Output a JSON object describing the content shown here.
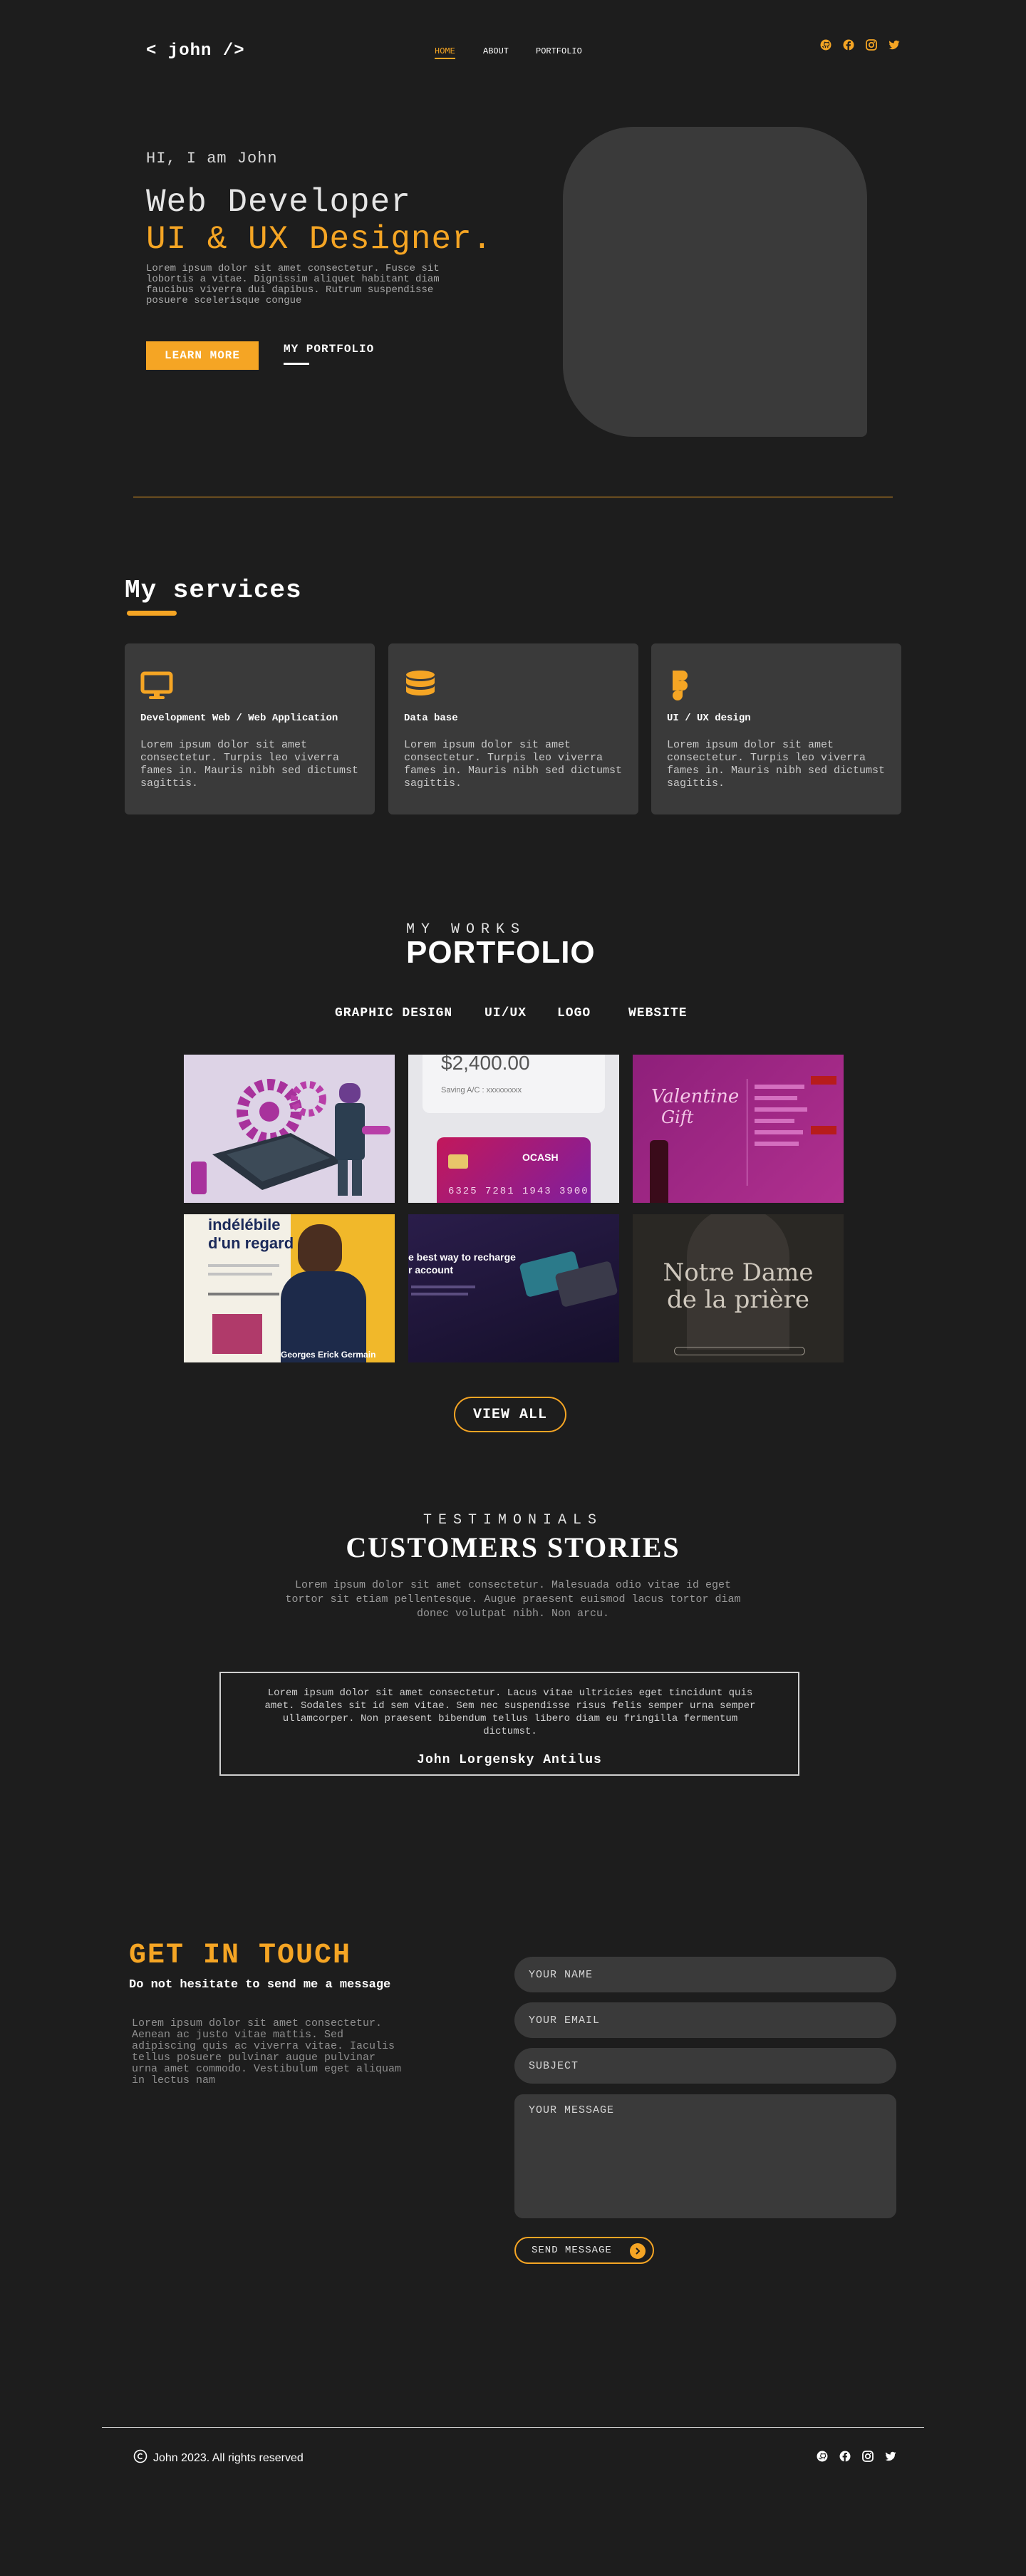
{
  "header": {
    "logo": "< john />",
    "nav": [
      {
        "label": "HOME",
        "active": true
      },
      {
        "label": "ABOUT",
        "active": false
      },
      {
        "label": "PORTFOLIO",
        "active": false
      }
    ],
    "socials": [
      "github-icon",
      "facebook-icon",
      "instagram-icon",
      "twitter-icon"
    ]
  },
  "hero": {
    "greeting": "HI, I am  John",
    "role_1": "Web Developer",
    "role_2": "UI & UX Designer.",
    "description": "Lorem ipsum dolor sit amet consectetur. Fusce sit lobortis a vitae. Dignissim aliquet habitant diam faucibus viverra dui dapibus. Rutrum suspendisse posuere scelerisque congue",
    "primary_button": "LEARN MORE",
    "secondary_button": "MY PORTFOLIO"
  },
  "services": {
    "title": "My services",
    "items": [
      {
        "icon": "monitor-icon",
        "title": "Development  Web / Web Application",
        "text": "Lorem ipsum dolor sit amet consectetur. Turpis leo viverra fames in. Mauris nibh sed dictumst sagittis."
      },
      {
        "icon": "database-icon",
        "title": "Data base",
        "text": "Lorem ipsum dolor sit amet consectetur. Turpis leo viverra fames in. Mauris nibh sed dictumst sagittis."
      },
      {
        "icon": "figma-icon",
        "title": "UI / UX design",
        "text": "Lorem ipsum dolor sit amet consectetur. Turpis leo viverra fames in. Mauris nibh sed dictumst sagittis."
      }
    ]
  },
  "portfolio": {
    "subtitle": "MY WORKS",
    "title": "PORTFOLIO",
    "tabs": [
      {
        "label": "GRAPHIC DESIGN",
        "active": true
      },
      {
        "label": "UI/UX",
        "active": false
      },
      {
        "label": "LOGO",
        "active": false
      },
      {
        "label": "WEBSITE",
        "active": false
      }
    ],
    "thumbs": [
      {
        "texts": []
      },
      {
        "texts": [
          "$2,400.00",
          "Saving A/C : xxxxxxxxx",
          "OCASH",
          "6325 7281 1943 3900"
        ]
      },
      {
        "texts": [
          "Valentine",
          "Gift"
        ]
      },
      {
        "texts": [
          "indélébile",
          "d'un regard",
          "Georges Erick Germain"
        ]
      },
      {
        "texts": [
          "e best way to recharge",
          "r account"
        ]
      },
      {
        "texts": [
          "Notre Dame",
          "de la prière"
        ]
      }
    ],
    "view_all": "VIEW ALL"
  },
  "testimonials": {
    "subtitle": "TESTIMONIALS",
    "title": "CUSTOMERS STORIES",
    "intro": "Lorem ipsum dolor sit amet consectetur. Malesuada odio vitae id eget tortor sit etiam pellentesque. Augue praesent euismod lacus tortor diam donec volutpat nibh. Non arcu.",
    "quote": "Lorem ipsum dolor sit amet consectetur. Lacus vitae ultricies eget tincidunt quis amet. Sodales sit id sem vitae. Sem nec suspendisse risus felis semper urna semper ullamcorper. Non praesent bibendum tellus libero diam eu fringilla fermentum dictumst.",
    "author": "John Lorgensky Antilus"
  },
  "contact": {
    "title": "GET IN TOUCH",
    "subtitle": "Do not hesitate to send me a message",
    "text": "Lorem ipsum dolor sit amet consectetur. Aenean ac justo vitae mattis. Sed adipiscing quis ac viverra vitae. Iaculis tellus posuere pulvinar augue pulvinar urna amet commodo. Vestibulum eget aliquam in lectus nam",
    "name_placeholder": "YOUR NAME",
    "email_placeholder": "YOUR EMAIL",
    "subject_placeholder": "SUBJECT",
    "message_placeholder": "YOUR MESSAGE",
    "send_button": "SEND MESSAGE"
  },
  "footer": {
    "copyright": "John 2023. All rights reserved"
  },
  "colors": {
    "accent": "#f5a524",
    "background": "#1d1d1d",
    "card": "#3a3a3a"
  }
}
